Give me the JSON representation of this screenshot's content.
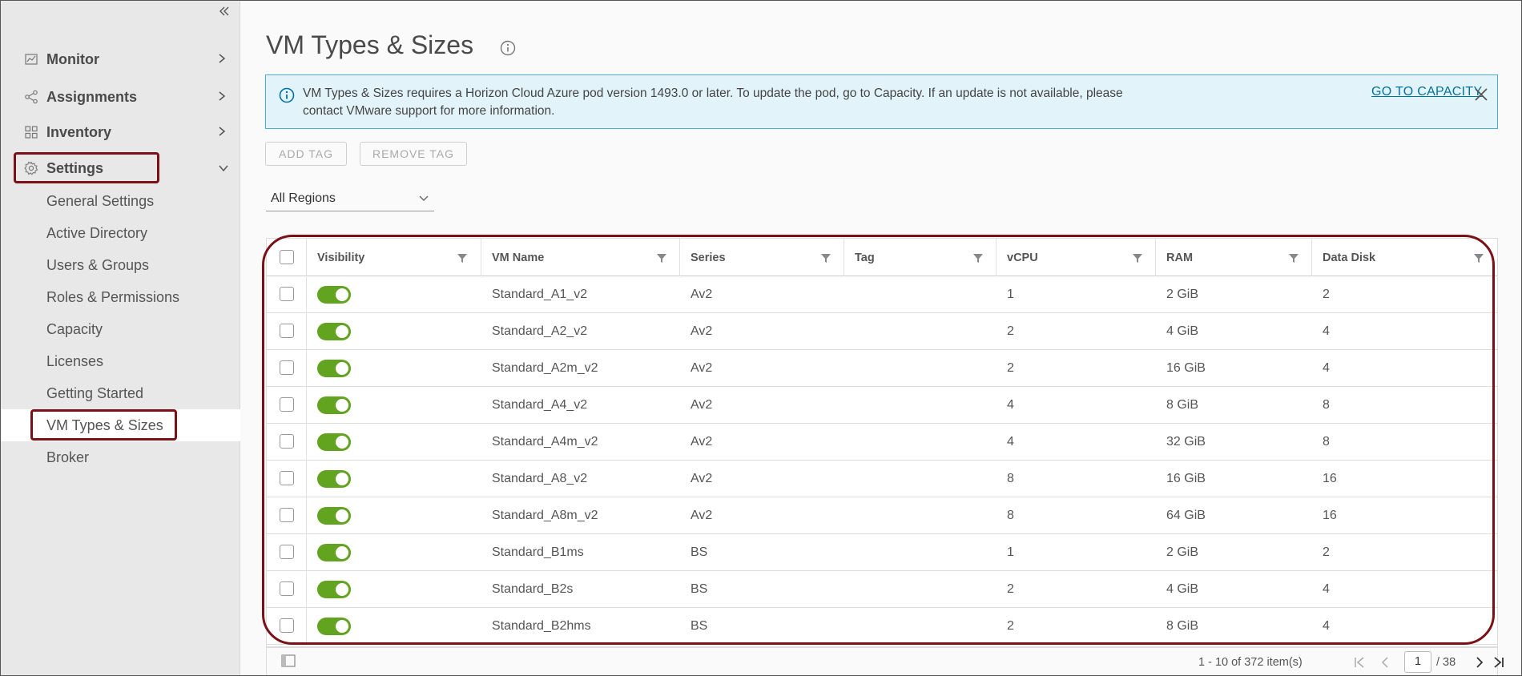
{
  "sidebar": {
    "collapse_icon": "double-chevron-left-icon",
    "nav": [
      {
        "label": "Monitor",
        "icon": "monitor-chart-icon"
      },
      {
        "label": "Assignments",
        "icon": "share-nodes-icon"
      },
      {
        "label": "Inventory",
        "icon": "grid-icon"
      },
      {
        "label": "Settings",
        "icon": "gear-icon"
      }
    ],
    "settings_items": [
      {
        "label": "General Settings"
      },
      {
        "label": "Active Directory"
      },
      {
        "label": "Users & Groups"
      },
      {
        "label": "Roles & Permissions"
      },
      {
        "label": "Capacity"
      },
      {
        "label": "Licenses"
      },
      {
        "label": "Getting Started"
      },
      {
        "label": "VM Types & Sizes"
      },
      {
        "label": "Broker"
      }
    ]
  },
  "main": {
    "title": "VM Types & Sizes",
    "alert": {
      "text": "VM Types & Sizes requires a Horizon Cloud Azure pod version 1493.0 or later. To update the pod, go to Capacity. If an update is not available, please contact VMware support for more information.",
      "link": "GO TO CAPACITY"
    },
    "toolbar": {
      "add_tag": "ADD TAG",
      "remove_tag": "REMOVE TAG"
    },
    "region_filter": {
      "selected": "All Regions"
    },
    "table": {
      "columns": [
        "Visibility",
        "VM Name",
        "Series",
        "Tag",
        "vCPU",
        "RAM",
        "Data Disk"
      ],
      "rows": [
        {
          "visible": true,
          "name": "Standard_A1_v2",
          "series": "Av2",
          "tag": "",
          "vcpu": "1",
          "ram": "2 GiB",
          "disk": "2"
        },
        {
          "visible": true,
          "name": "Standard_A2_v2",
          "series": "Av2",
          "tag": "",
          "vcpu": "2",
          "ram": "4 GiB",
          "disk": "4"
        },
        {
          "visible": true,
          "name": "Standard_A2m_v2",
          "series": "Av2",
          "tag": "",
          "vcpu": "2",
          "ram": "16 GiB",
          "disk": "4"
        },
        {
          "visible": true,
          "name": "Standard_A4_v2",
          "series": "Av2",
          "tag": "",
          "vcpu": "4",
          "ram": "8 GiB",
          "disk": "8"
        },
        {
          "visible": true,
          "name": "Standard_A4m_v2",
          "series": "Av2",
          "tag": "",
          "vcpu": "4",
          "ram": "32 GiB",
          "disk": "8"
        },
        {
          "visible": true,
          "name": "Standard_A8_v2",
          "series": "Av2",
          "tag": "",
          "vcpu": "8",
          "ram": "16 GiB",
          "disk": "16"
        },
        {
          "visible": true,
          "name": "Standard_A8m_v2",
          "series": "Av2",
          "tag": "",
          "vcpu": "8",
          "ram": "64 GiB",
          "disk": "16"
        },
        {
          "visible": true,
          "name": "Standard_B1ms",
          "series": "BS",
          "tag": "",
          "vcpu": "1",
          "ram": "2 GiB",
          "disk": "2"
        },
        {
          "visible": true,
          "name": "Standard_B2s",
          "series": "BS",
          "tag": "",
          "vcpu": "2",
          "ram": "4 GiB",
          "disk": "4"
        },
        {
          "visible": true,
          "name": "Standard_B2hms",
          "series": "BS",
          "tag": "",
          "vcpu": "2",
          "ram": "8 GiB",
          "disk": "4"
        }
      ]
    },
    "footer": {
      "count_text": "1 - 10 of 372 item(s)",
      "current_page": "1",
      "total_pages": "/ 38"
    }
  },
  "colors": {
    "accent_link": "#0072a3",
    "toggle_on": "#62a420",
    "highlight": "#7b1116",
    "alert_bg": "#e2f4fa"
  }
}
